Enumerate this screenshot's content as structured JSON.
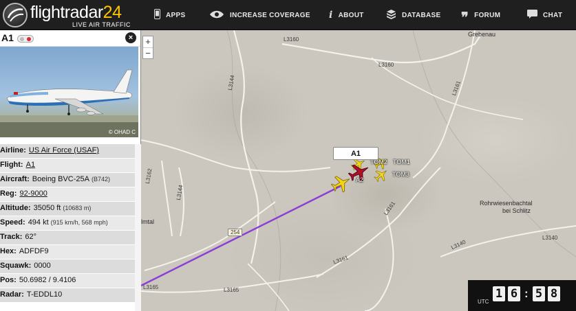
{
  "brand": {
    "name_part1": "flightradar",
    "name_part2": "24",
    "tagline": "LIVE AIR TRAFFIC"
  },
  "nav": [
    {
      "label": "APPS",
      "icon": "phone-icon"
    },
    {
      "label": "INCREASE COVERAGE",
      "icon": "eye-icon"
    },
    {
      "label": "ABOUT",
      "icon": "info-icon"
    },
    {
      "label": "DATABASE",
      "icon": "database-icon"
    },
    {
      "label": "FORUM",
      "icon": "quote-icon"
    },
    {
      "label": "CHAT",
      "icon": "chat-bubble-icon"
    }
  ],
  "zoom": {
    "in": "+",
    "out": "−"
  },
  "panel": {
    "title": "A1",
    "photo_credit": "© OHAD C",
    "rows": {
      "airline_k": "Airline:",
      "airline_v": "US Air Force (USAF)",
      "flight_k": "Flight:",
      "flight_v": "A1",
      "aircraft_k": "Aircraft:",
      "aircraft_v": "Boeing BVC-25A",
      "aircraft_s": "(B742)",
      "reg_k": "Reg:",
      "reg_v": "92-9000",
      "altitude_k": "Altitude:",
      "altitude_v": "35050 ft",
      "altitude_s": "(10683 m)",
      "speed_k": "Speed:",
      "speed_v": "494 kt",
      "speed_s": "(915 km/h, 568 mph)",
      "track_k": "Track:",
      "track_v": "62°",
      "hex_k": "Hex:",
      "hex_v": "ADFDF9",
      "squawk_k": "Squawk:",
      "squawk_v": "0000",
      "pos_k": "Pos:",
      "pos_v": "50.6982 / 9.4106",
      "radar_k": "Radar:",
      "radar_v": "T-EDDL10"
    }
  },
  "map": {
    "roads": [
      "L3160",
      "L3160",
      "L3144",
      "L3161",
      "L3162",
      "L3144",
      "L3161",
      "L3140",
      "L3140",
      "L3161",
      "L3165",
      "L3165",
      "254"
    ],
    "places": [
      "Grebenau",
      "Rohrwiesenbachtal",
      "bei Schlitz",
      "lmtal"
    ],
    "flight_label": "A1",
    "plane_labels": [
      "TOM2",
      "TOM1",
      "TOM3",
      "A2"
    ],
    "track_color": "#8a3fd6"
  },
  "clock": {
    "label": "UTC",
    "d1": "1",
    "d2": "6",
    "sep": ":",
    "d3": "5",
    "d4": "8"
  }
}
